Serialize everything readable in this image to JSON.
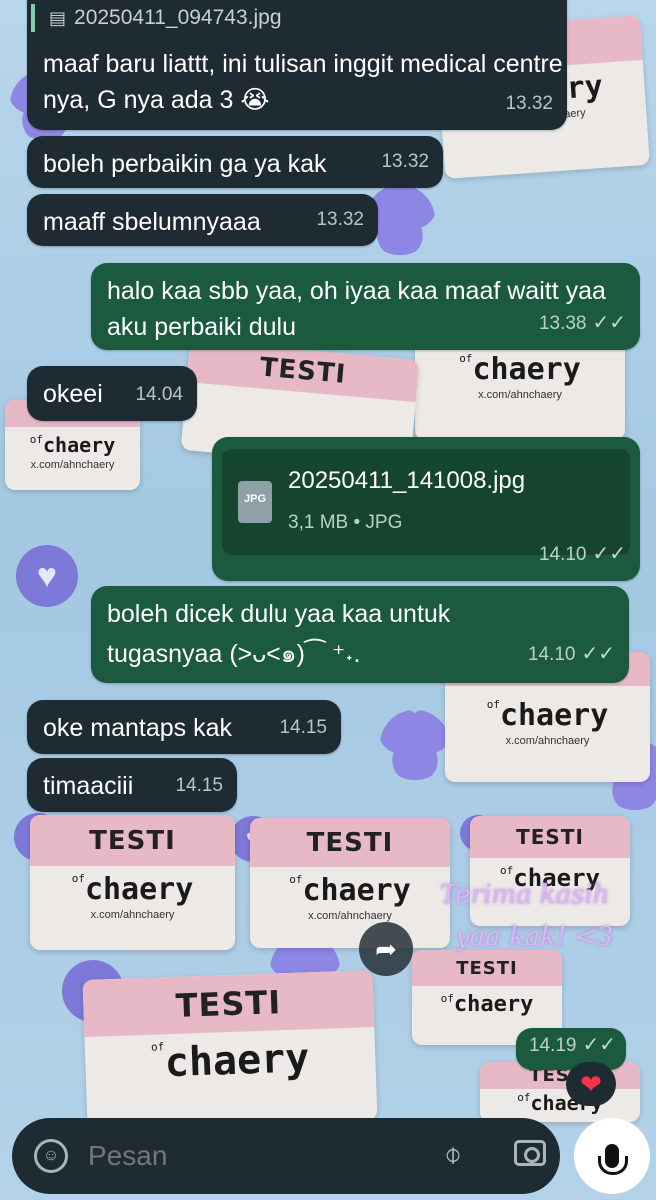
{
  "wallpaper": {
    "sticker_title": "TESTI",
    "sticker_of": "of",
    "sticker_brand": "chaery",
    "sticker_url": "x.com/ahnchaery",
    "deco_line1": "Terima kasih",
    "deco_line2": "yaa kak! <3"
  },
  "messages": [
    {
      "header": "20250411_094743.jpg",
      "text": "maaf baru liattt, ini tulisan inggit medical centre nya, G nya ada 3 😭",
      "time": "13.32"
    },
    {
      "text": "boleh perbaikin ga ya kak",
      "time": "13.32"
    },
    {
      "text": "maaff sbelumnyaaa",
      "time": "13.32"
    },
    {
      "text": "halo kaa sbb yaa, oh iyaa kaa maaf waitt yaa aku perbaiki dulu",
      "time": "13.38"
    },
    {
      "text": "okeei",
      "time": "14.04"
    },
    {
      "file_name": "20250411_141008.jpg",
      "file_meta": "3,1 MB • JPG",
      "file_type": "JPG",
      "time": "14.10"
    },
    {
      "text": "boleh dicek dulu yaa kaa untuk tugasnyaa (>ᴗ<๑)⁀ ⁺˖.",
      "time": "14.10"
    },
    {
      "text": "oke mantaps kak",
      "time": "14.15"
    },
    {
      "text": "timaaciii",
      "time": "14.15"
    },
    {
      "time": "14.19"
    }
  ],
  "ticks": "✓✓",
  "reaction": "❤",
  "composer": {
    "placeholder": "Pesan"
  },
  "icons": {
    "emoji": "emoji-icon",
    "attach": "paperclip-icon",
    "camera": "camera-icon",
    "mic": "microphone-icon",
    "forward": "forward-icon"
  }
}
